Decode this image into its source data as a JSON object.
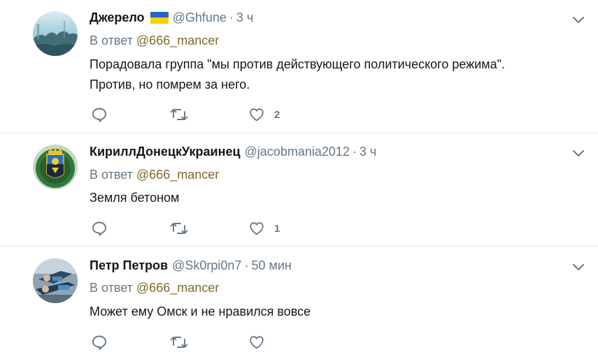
{
  "colors": {
    "name": "#14171a",
    "secondary": "#657786",
    "mention": "#7d6a2c",
    "divider": "#e6ecf0",
    "flag_blue": "#2a64c4",
    "flag_yellow": "#f5d100"
  },
  "replies": [
    {
      "name": "Джерело",
      "has_flag": true,
      "handle": "@Ghfune",
      "separator": "·",
      "time": "3 ч",
      "reply_prefix": "В ответ",
      "reply_to": "@666_mancer",
      "text_lines": [
        "Порадовала группа \"мы против действующего политического режима\".",
        "Против, но помрем за него."
      ],
      "likes": "2",
      "icons": {
        "reply": "reply-icon",
        "retweet": "retweet-icon",
        "like": "heart-icon",
        "menu": "chevron-down-icon"
      }
    },
    {
      "name": "КириллДонецкУкраинец",
      "has_flag": false,
      "handle": "@jacobmania2012",
      "separator": "·",
      "time": "3 ч",
      "reply_prefix": "В ответ",
      "reply_to": "@666_mancer",
      "text_lines": [
        "Земля бетоном"
      ],
      "likes": "1",
      "icons": {
        "reply": "reply-icon",
        "retweet": "retweet-icon",
        "like": "heart-icon",
        "menu": "chevron-down-icon"
      }
    },
    {
      "name": "Петр Петров",
      "has_flag": false,
      "handle": "@Sk0rpi0n7",
      "separator": "·",
      "time": "50 мин",
      "reply_prefix": "В ответ",
      "reply_to": "@666_mancer",
      "text_lines": [
        "Может ему Омск и не нравился вовсе"
      ],
      "likes": "",
      "icons": {
        "reply": "reply-icon",
        "retweet": "retweet-icon",
        "like": "heart-icon",
        "menu": "chevron-down-icon"
      }
    }
  ]
}
